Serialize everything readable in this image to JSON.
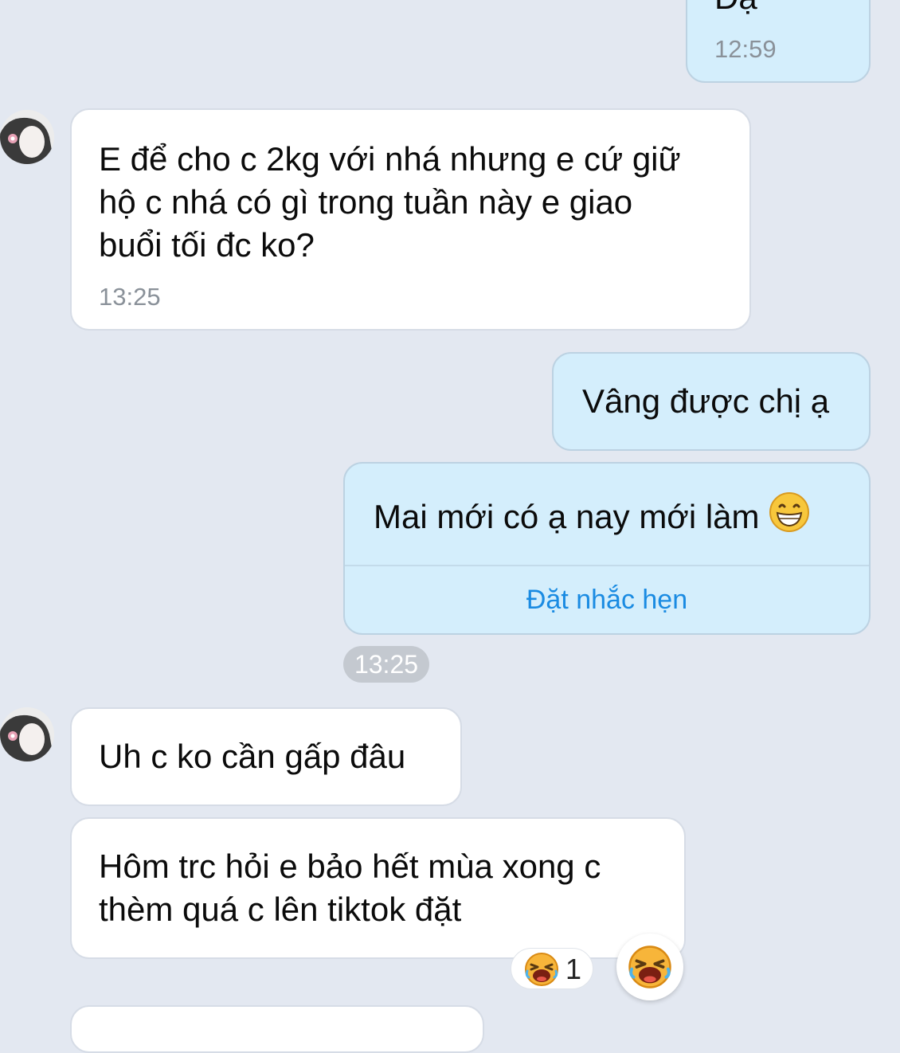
{
  "colors": {
    "background": "#e3e8f1",
    "incoming_bubble": "#ffffff",
    "outgoing_bubble": "#d4eefc",
    "link": "#1a8be2",
    "timestamp": "#8a9199"
  },
  "messages": [
    {
      "id": "m1",
      "direction": "out",
      "lines": [
        "Dạ"
      ],
      "time": "12:59"
    },
    {
      "id": "m2",
      "direction": "in",
      "avatar": "user-avatar",
      "lines": [
        "E để cho c 2kg với nhá nhưng e cứ giữ",
        "hộ c nhá có gì trong tuần này e giao",
        "buổi tối đc ko?"
      ],
      "time": "13:25"
    },
    {
      "id": "m3",
      "direction": "out",
      "lines": [
        "Vâng được chị ạ"
      ]
    },
    {
      "id": "m4",
      "direction": "out",
      "lines": [
        "Mai mới có ạ nay mới làm"
      ],
      "emoji": "grinning-face-icon",
      "action": "Đặt nhắc hẹn"
    },
    {
      "id": "m5",
      "direction": "in",
      "avatar": "user-avatar",
      "lines": [
        "Uh c ko cần gấp đâu"
      ]
    },
    {
      "id": "m6",
      "direction": "in",
      "lines": [
        "Hôm trc hỏi e bảo hết mùa xong c",
        "thèm quá c lên tiktok đặt"
      ],
      "reaction": {
        "icon": "laughing-face-icon",
        "count": "1"
      }
    }
  ],
  "time_separator": "13:25",
  "reaction_button": {
    "icon": "laughing-face-icon"
  }
}
